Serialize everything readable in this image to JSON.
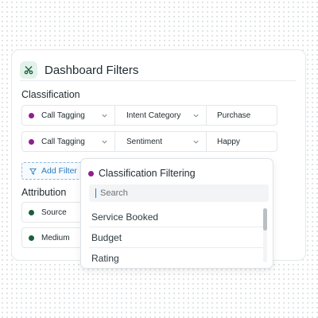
{
  "header": {
    "title": "Dashboard Filters",
    "icon": "scissors-icon"
  },
  "classification": {
    "label": "Classification",
    "rows": [
      {
        "field": "Call Tagging",
        "category": "Intent Category",
        "value": "Purchase"
      },
      {
        "field": "Call Tagging",
        "category": "Sentiment",
        "value": "Happy"
      }
    ]
  },
  "add_filter": {
    "label": "Add Filter"
  },
  "attribution": {
    "label": "Attribution",
    "rows": [
      {
        "field": "Source"
      },
      {
        "field": "Medium"
      }
    ]
  },
  "dropdown": {
    "title": "Classification Filtering",
    "search_placeholder": "Search",
    "options": [
      "Service Booked",
      "Budget",
      "Rating"
    ]
  },
  "colors": {
    "classification_dot": "#8e1f8e",
    "attribution_dot": "#1b5e3b",
    "accent": "#2b7bbf",
    "icon_bg": "#e2f2ea"
  }
}
